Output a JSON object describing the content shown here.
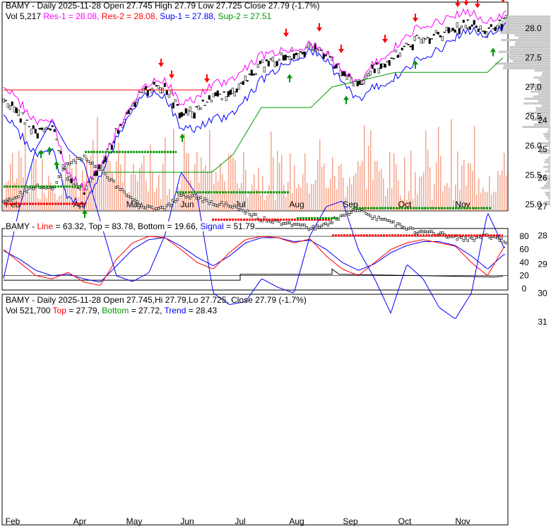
{
  "colors": {
    "res1": "#ff00ff",
    "res2": "#ff0000",
    "sup1": "#0000ff",
    "sup2": "#009900",
    "volume": "#f4a58c",
    "up": "#009900",
    "down": "#ff0000"
  },
  "panel1": {
    "ticker": "BAMY",
    "legend1": "BAMY - Daily 2025-11-28 Open 27.745  High 27.79  Low 27.725  Close 27.79 (-1.7%)",
    "vol": "Vol 5,217",
    "res1": "Res-1 = 28.08,",
    "res2": "Res-2 = 28.08,",
    "sup1": "Sup-1 = 27.88,",
    "sup2": "Sup-2 = 27.51"
  },
  "panel2": {
    "prefix": "BAMY - ",
    "line": "Line",
    "line_val": "= 63.32, Top = 83.78, Bottom = 19.66,",
    "signal": "Signal",
    "signal_val": "= 51.79"
  },
  "panel3": {
    "legend1": "BAMY - Daily 2025-11-28 Open 27.745,Hi 27.79,Lo 27.725, Close 27.79 (-1.7%)",
    "vol": "Vol 521,700",
    "top": "Top",
    "top_val": "= 27.79,",
    "bottom": "Bottom",
    "bottom_val": "= 27.72,",
    "trend": "Trend",
    "trend_val": "= 28.43"
  },
  "chart_data": [
    {
      "type": "line",
      "title": "BAMY - Daily price with support/resistance",
      "months": [
        "Feb",
        "Apr",
        "May",
        "Jun",
        "Jul",
        "Aug",
        "Sep",
        "Oct",
        "Nov"
      ],
      "yticks": [
        "28.0",
        "27.5",
        "27.0",
        "26.5",
        "26.0",
        "25.5",
        "25.0"
      ],
      "ylim": [
        25.0,
        28.2
      ],
      "close": [
        26.8,
        26.5,
        26.2,
        26.3,
        25.4,
        25.2,
        25.6,
        26.2,
        26.7,
        26.95,
        27.0,
        26.5,
        26.6,
        26.8,
        26.85,
        27.1,
        27.35,
        27.45,
        27.55,
        27.65,
        27.55,
        27.2,
        27.0,
        27.3,
        27.45,
        27.65,
        27.85,
        27.85,
        28.0,
        28.05,
        27.9,
        28.1
      ]
    },
    {
      "type": "line",
      "title": "Oscillator",
      "yticks": [
        "80",
        "60",
        "40",
        "20",
        "0"
      ],
      "ylim": [
        0,
        90
      ],
      "line": [
        60,
        40,
        20,
        15,
        25,
        10,
        5,
        45,
        70,
        80,
        78,
        60,
        40,
        30,
        55,
        75,
        80,
        78,
        70,
        76,
        50,
        30,
        20,
        40,
        60,
        70,
        75,
        70,
        65,
        40,
        20,
        63
      ],
      "signal": [
        58,
        45,
        28,
        20,
        22,
        15,
        10,
        35,
        60,
        75,
        78,
        65,
        48,
        35,
        50,
        70,
        78,
        78,
        72,
        74,
        60,
        40,
        28,
        38,
        55,
        66,
        72,
        72,
        66,
        50,
        30,
        52
      ]
    },
    {
      "type": "line",
      "title": "Trend",
      "yticks": [
        "31",
        "30",
        "29",
        "28",
        "27",
        "26",
        "25",
        "24"
      ],
      "ylim": [
        23.6,
        31.3
      ],
      "trend": [
        29.5,
        27,
        25,
        24,
        25,
        25.5,
        27.5,
        29.4,
        29.6,
        29.3,
        28,
        25.8,
        26.6,
        30,
        30.4,
        30.3,
        29.5,
        29.8,
        30,
        28,
        27,
        26.8,
        28.5,
        29.5,
        30.7,
        29,
        29.5,
        30.5,
        30.9,
        30,
        27.2,
        28.4
      ]
    }
  ]
}
